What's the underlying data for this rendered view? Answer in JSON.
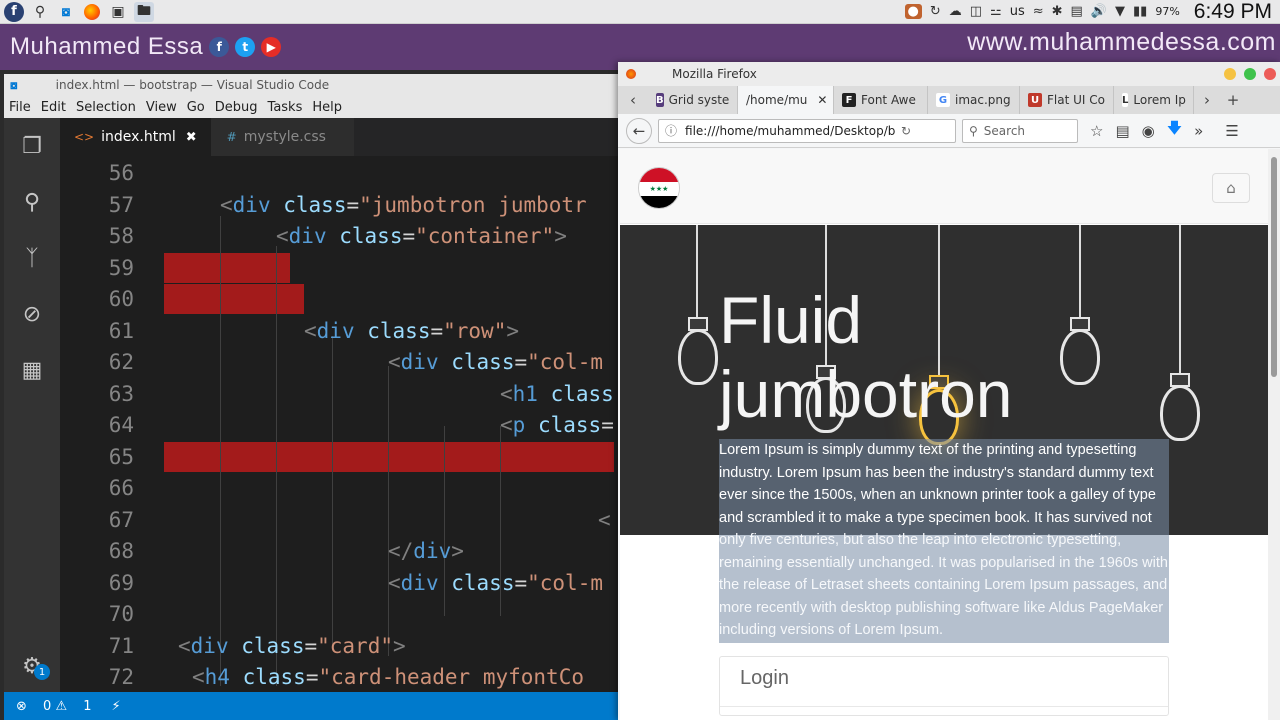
{
  "system_bar": {
    "keyboard_layout": "us",
    "battery": "97%",
    "clock": "6:49 PM"
  },
  "banner": {
    "name": "Muhammed Essa",
    "url": "www.muhammedessa.com",
    "social": [
      {
        "icon": "facebook-icon",
        "glyph": "f"
      },
      {
        "icon": "twitter-icon",
        "glyph": "t"
      },
      {
        "icon": "youtube-icon",
        "glyph": "▶"
      }
    ]
  },
  "vscode": {
    "title": "index.html — bootstrap — Visual Studio Code",
    "menu": [
      "File",
      "Edit",
      "Selection",
      "View",
      "Go",
      "Debug",
      "Tasks",
      "Help"
    ],
    "tabs": [
      {
        "label": "index.html",
        "icon": "<>",
        "active": true
      },
      {
        "label": "mystyle.css",
        "icon": "#",
        "active": false
      }
    ],
    "status": {
      "errors": "0",
      "warnings": "1"
    },
    "notification_badge": "1"
  },
  "firefox": {
    "title": "Mozilla Firefox",
    "tabs": [
      {
        "label": "Grid syste",
        "icon": "B"
      },
      {
        "label": "/home/mu",
        "icon": "",
        "active": true
      },
      {
        "label": "Font Awe",
        "icon": "F"
      },
      {
        "label": "imac.png",
        "icon": "G"
      },
      {
        "label": "Flat UI Co",
        "icon": "U"
      },
      {
        "label": "Lorem Ip",
        "icon": "L"
      }
    ],
    "url": "file:///home/muhammed/Desktop/bo",
    "search_placeholder": "Search"
  },
  "webpage": {
    "jumbotron_title_1": "Fluid",
    "jumbotron_title_2": "jumbotron",
    "jumbotron_text_upper": "Lorem Ipsum is simply dummy text of the printing and typesetting industry. Lorem Ipsum has been the industry's standard dummy text ever since the 1500s, when an unknown printer took a galley of type and scrambled it to make a type specimen book. It has survived not",
    "jumbotron_text_lower": "only five centuries, but also the leap into electronic typesetting, remaining essentially unchanged. It was popularised in the 1960s with the release of Letraset sheets containing Lorem Ipsum passages, and more recently with desktop publishing software like Aldus PageMaker including versions of Lorem Ipsum.",
    "card_header": "Login"
  },
  "colors": {
    "banner": "#5e3b73",
    "vscode_status": "#007acc",
    "error_highlight": "#a31b1b"
  }
}
